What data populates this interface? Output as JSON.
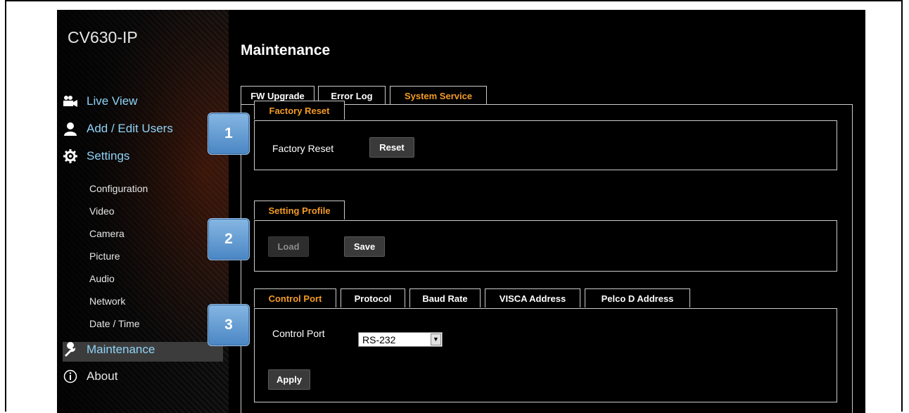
{
  "app": {
    "title": "CV630-IP"
  },
  "nav": {
    "live_view": "Live View",
    "add_edit_users": "Add / Edit Users",
    "settings": "Settings",
    "sub": [
      "Configuration",
      "Video",
      "Camera",
      "Picture",
      "Audio",
      "Network",
      "Date / Time"
    ],
    "maintenance": "Maintenance",
    "about": "About"
  },
  "page": {
    "title": "Maintenance",
    "tabs": [
      "FW Upgrade",
      "Error Log",
      "System Service"
    ],
    "active_tab": "System Service"
  },
  "factory_reset": {
    "tab": "Factory Reset",
    "label": "Factory Reset",
    "reset_button": "Reset"
  },
  "setting_profile": {
    "tab": "Setting Profile",
    "load_button": "Load",
    "save_button": "Save"
  },
  "control": {
    "tabs": [
      "Control Port",
      "Protocol",
      "Baud Rate",
      "VISCA Address",
      "Pelco D Address"
    ],
    "active_tab": "Control Port",
    "label": "Control Port",
    "value": "RS-232",
    "apply_button": "Apply"
  },
  "badges": [
    "1",
    "2",
    "3"
  ],
  "colors": {
    "accent_orange": "#f39a25",
    "nav_blue": "#8fd3f7",
    "badge_blue": "#5b95cf"
  },
  "icons": [
    "camera-icon",
    "user-icon",
    "gear-icon",
    "wrench-icon",
    "info-icon",
    "dropdown-arrow-icon"
  ]
}
